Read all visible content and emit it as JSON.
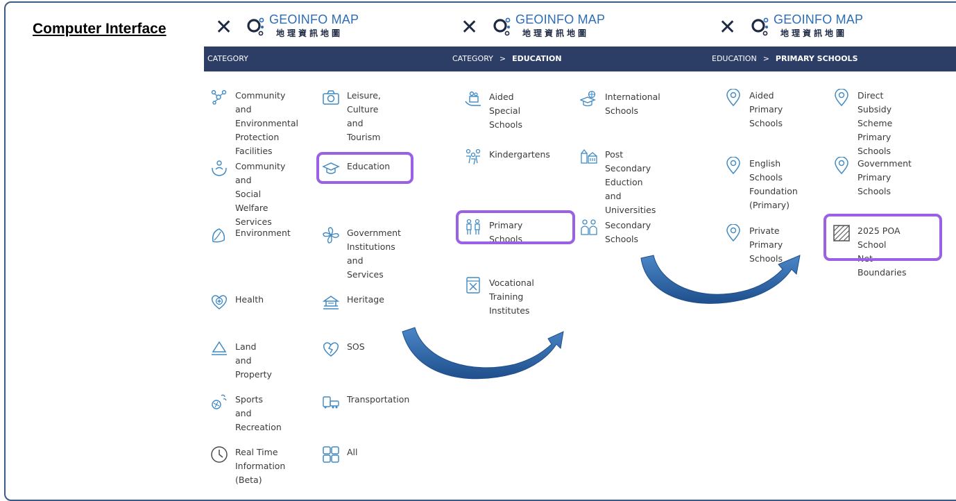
{
  "title": "Computer Interface",
  "app": {
    "logo_en": "GEOINFO MAP",
    "logo_zh": "地理資訊地圖",
    "close_glyph": "✕",
    "crumb_sep": ">"
  },
  "panels": [
    {
      "breadcrumb": [
        "CATEGORY"
      ],
      "items": [
        {
          "label": "Community and\nEnvironmental\nProtection\nFacilities",
          "icon": "community-network-icon"
        },
        {
          "label": "Leisure, Culture\nand Tourism",
          "icon": "camera-icon"
        },
        {
          "label": "Community and\nSocial Welfare\nServices",
          "icon": "welfare-hands-icon"
        },
        {
          "label": "Education",
          "icon": "graduation-cap-icon"
        },
        {
          "label": "Environment",
          "icon": "leaf-icon"
        },
        {
          "label": "Government\nInstitutions and\nServices",
          "icon": "bauhinia-icon"
        },
        {
          "label": "Health",
          "icon": "heart-plus-icon"
        },
        {
          "label": "Heritage",
          "icon": "pavilion-icon"
        },
        {
          "label": "Land and\nProperty",
          "icon": "land-icon"
        },
        {
          "label": "SOS",
          "icon": "broken-heart-icon"
        },
        {
          "label": "Sports and\nRecreation",
          "icon": "sports-icon"
        },
        {
          "label": "Transportation",
          "icon": "vehicles-icon"
        },
        {
          "label": "Real Time\nInformation\n(Beta)",
          "icon": "clock-icon"
        },
        {
          "label": "All",
          "icon": "grid-icon"
        }
      ]
    },
    {
      "breadcrumb": [
        "CATEGORY",
        "EDUCATION"
      ],
      "items": [
        {
          "label": "Aided Special\nSchools",
          "icon": "special-school-icon"
        },
        {
          "label": "International\nSchools",
          "icon": "globe-cap-icon"
        },
        {
          "label": "Kindergartens",
          "icon": "kids-icon"
        },
        {
          "label": "Post Secondary\nEduction and\nUniversities",
          "icon": "university-icon"
        },
        {
          "label": "Primary Schools",
          "icon": "pupils-icon"
        },
        {
          "label": "Secondary\nSchools",
          "icon": "students-icon"
        },
        {
          "label": "Vocational\nTraining\nInstitutes",
          "icon": "tools-book-icon"
        }
      ]
    },
    {
      "breadcrumb": [
        "EDUCATION",
        "PRIMARY SCHOOLS"
      ],
      "items": [
        {
          "label": "Aided Primary\nSchools",
          "icon": "map-pin-icon"
        },
        {
          "label": "Direct Subsidy\nScheme Primary\nSchools",
          "icon": "map-pin-icon"
        },
        {
          "label": "English Schools\nFoundation\n(Primary)",
          "icon": "map-pin-icon"
        },
        {
          "label": "Government\nPrimary Schools",
          "icon": "map-pin-icon"
        },
        {
          "label": "Private Primary\nSchools",
          "icon": "map-pin-icon"
        },
        {
          "label": "2025 POA School\nNet Boundaries",
          "icon": "hatched-area-icon"
        }
      ]
    }
  ],
  "colors": {
    "bar": "#2c3e66",
    "icon": "#3f8ac4",
    "highlight": "#9a61e6",
    "arrow": "#2e5d99"
  }
}
